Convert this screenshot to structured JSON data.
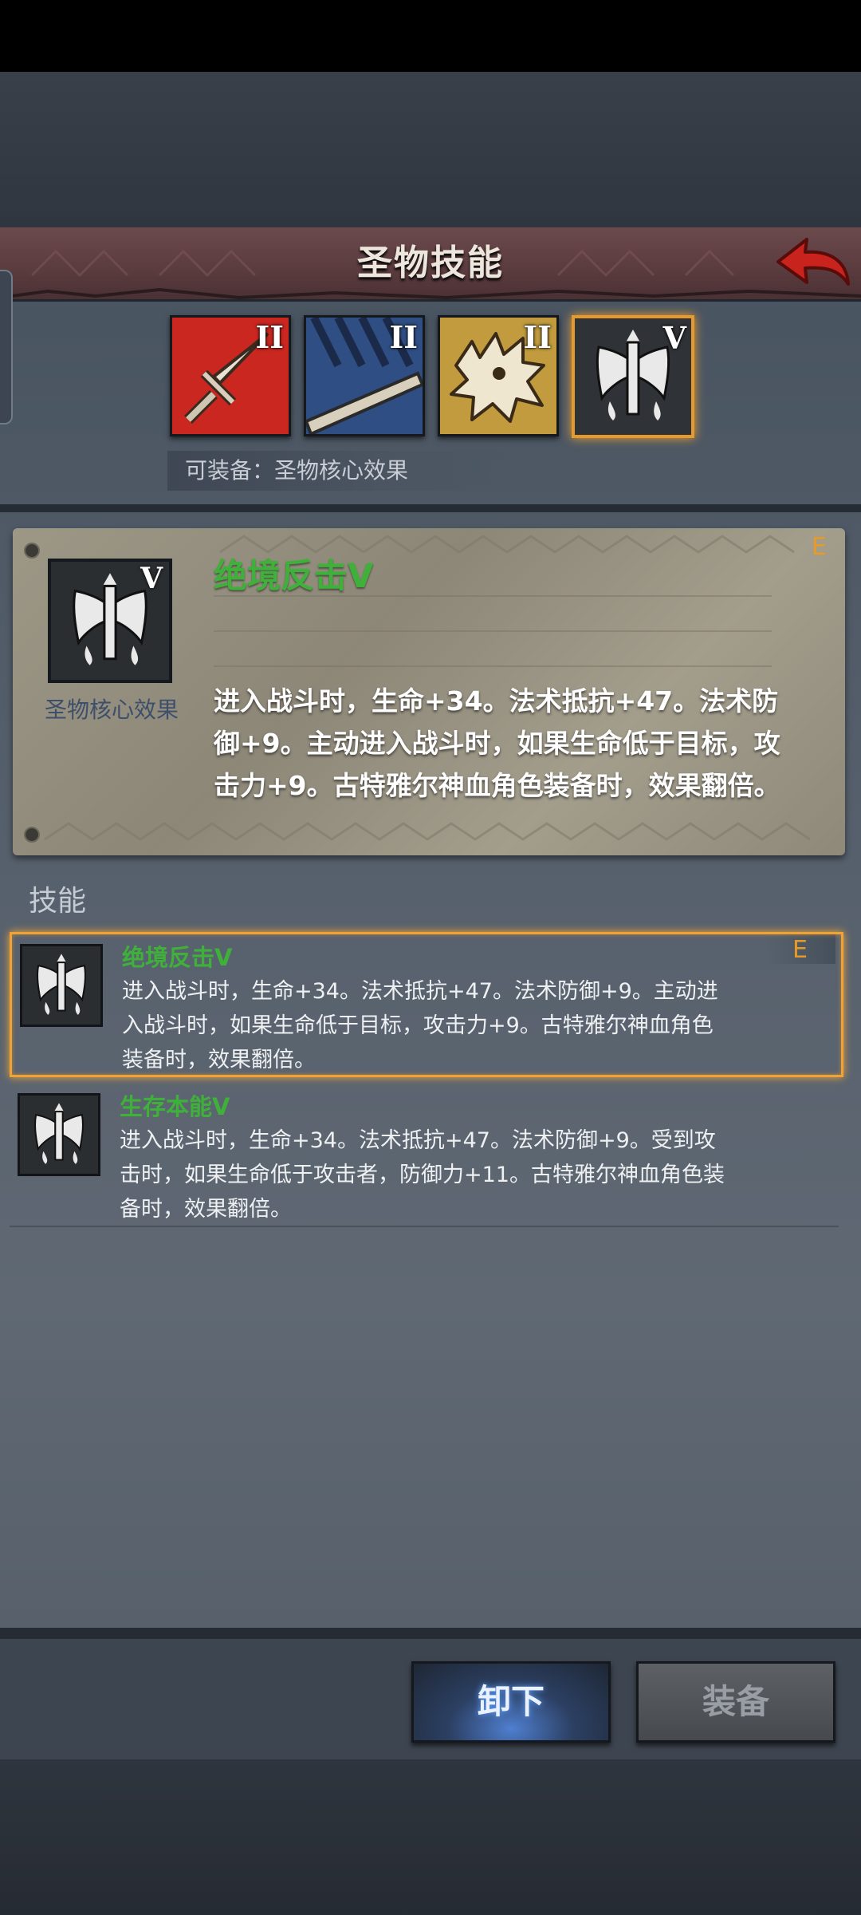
{
  "header": {
    "title": "圣物技能"
  },
  "relics": [
    {
      "name": "sword",
      "grade": "II",
      "color": "#c9271f"
    },
    {
      "name": "blade",
      "grade": "II",
      "color": "#2f4e84"
    },
    {
      "name": "beast",
      "grade": "II",
      "color": "#c19b3d"
    },
    {
      "name": "axe",
      "grade": "V",
      "color": "#2f3337",
      "selected": true
    }
  ],
  "equip_hint": "可装备：圣物核心效果",
  "detail": {
    "icon_grade": "V",
    "icon_label": "圣物核心效果",
    "title": "绝境反击V",
    "grade": "E",
    "description": "进入战斗时，生命+34。法术抵抗+47。法术防御+9。主动进入战斗时，如果生命低于目标，攻击力+9。古特雅尔神血角色装备时，效果翻倍。"
  },
  "skills_section_label": "技能",
  "skills": [
    {
      "name": "绝境反击V",
      "grade": "E",
      "selected": true,
      "description": "进入战斗时，生命+34。法术抵抗+47。法术防御+9。主动进入战斗时，如果生命低于目标，攻击力+9。古特雅尔神血角色装备时，效果翻倍。"
    },
    {
      "name": "生存本能V",
      "description": "进入战斗时，生命+34。法术抵抗+47。法术防御+9。受到攻击时，如果生命低于攻击者，防御力+11。古特雅尔神血角色装备时，效果翻倍。"
    }
  ],
  "buttons": {
    "unequip": "卸下",
    "equip": "装备"
  },
  "colors": {
    "accent_orange": "#f2a133",
    "skill_green": "#3fb13a",
    "header_red": "#6b4a4c"
  }
}
